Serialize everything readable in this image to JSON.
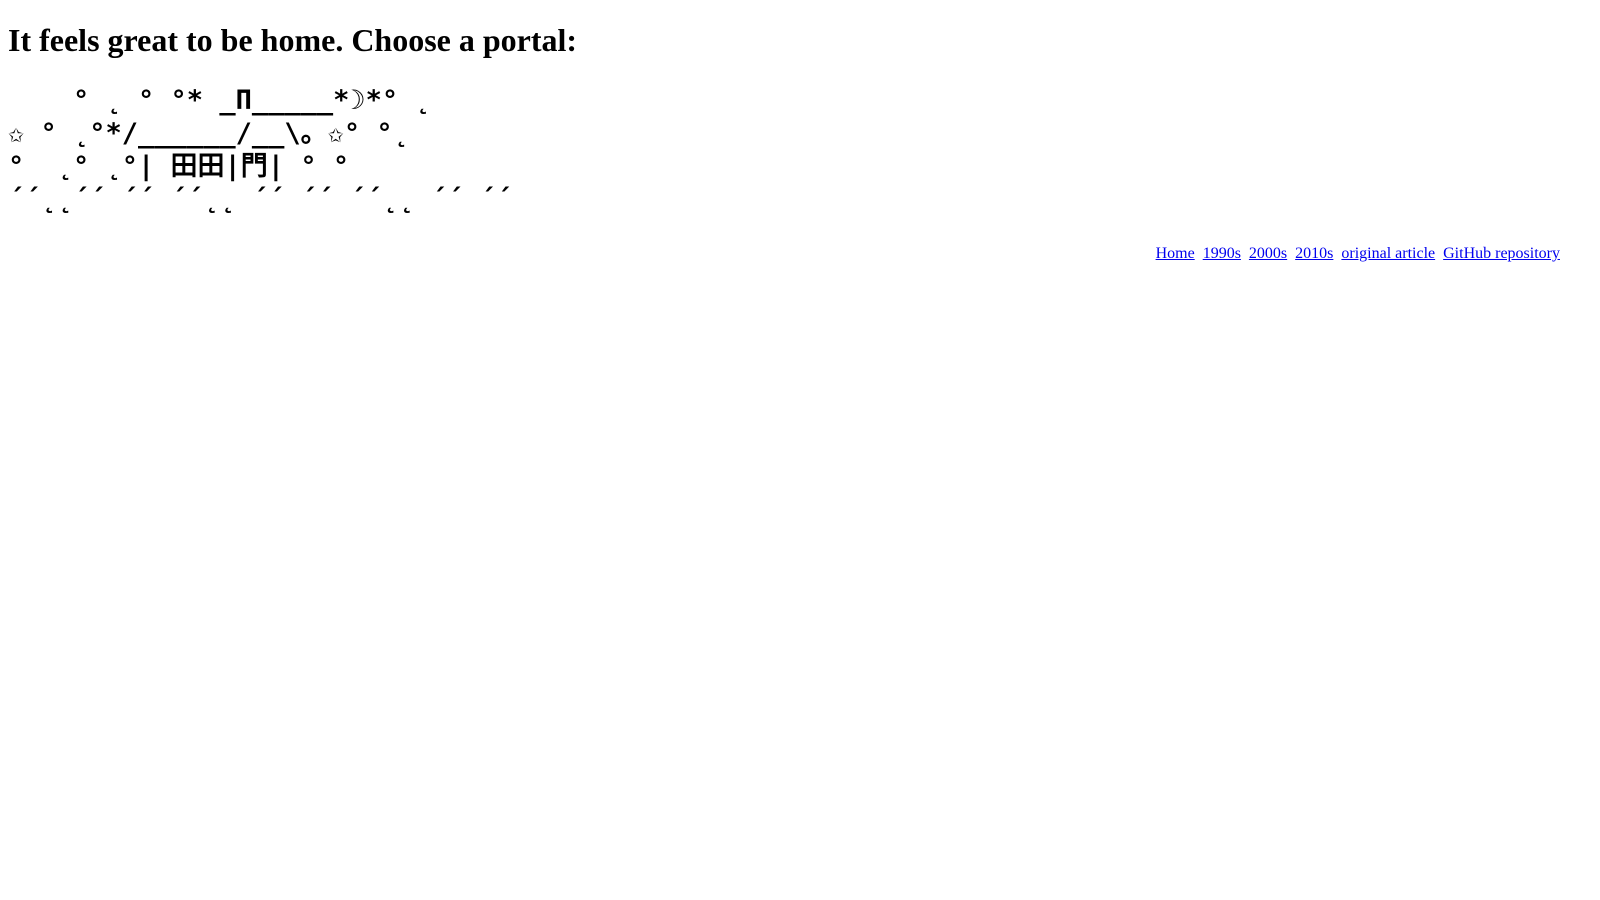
{
  "page": {
    "title": "It feels great to be home. Choose a portal:"
  },
  "ascii_art": {
    "lines": [
      "    ° ˛ ° °* _Π_____*☽*° ˛",
      "✩ ° ˛°*/______/__\\。✩° °˛",
      "°  ˛° ˛°| 田田|門| ° °",
      "´´˛˛´´ ´´ ´´˛˛ ´´ ´´ ´´˛˛ ´´ ´´"
    ]
  },
  "nav": {
    "links": [
      "Home",
      "1990s",
      "2000s",
      "2010s",
      "original article",
      "GitHub repository"
    ],
    "link_color": "#0000ee"
  }
}
